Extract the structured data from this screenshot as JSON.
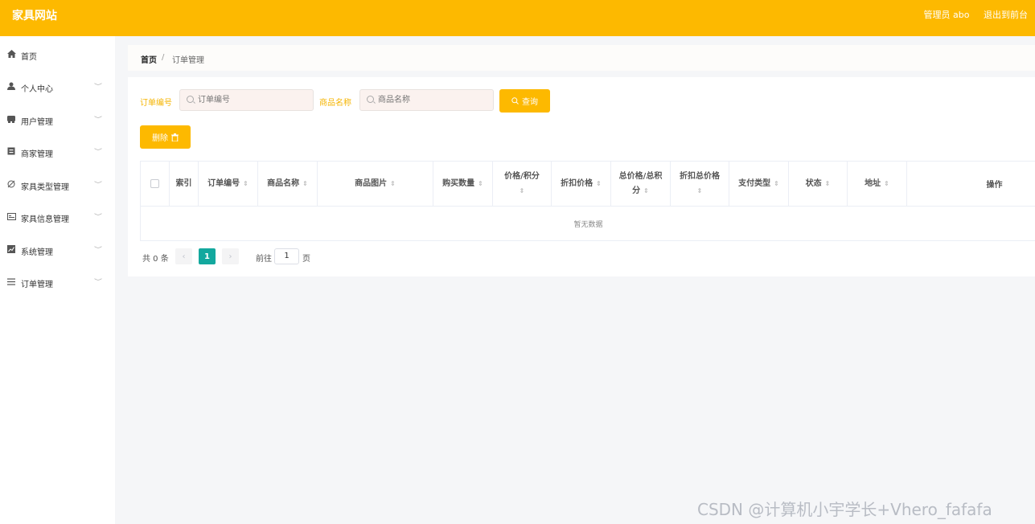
{
  "header": {
    "title": "家具网站",
    "admin_label": "管理员 abo",
    "exit_label": "退出到前台"
  },
  "sidebar": {
    "items": [
      {
        "label": "首页",
        "icon": "home-icon"
      },
      {
        "label": "个人中心",
        "icon": "user-icon"
      },
      {
        "label": "用户管理",
        "icon": "users-icon"
      },
      {
        "label": "商家管理",
        "icon": "merchant-icon"
      },
      {
        "label": "家具类型管理",
        "icon": "category-icon"
      },
      {
        "label": "家具信息管理",
        "icon": "info-icon"
      },
      {
        "label": "系统管理",
        "icon": "chart-icon"
      },
      {
        "label": "订单管理",
        "icon": "list-icon"
      }
    ]
  },
  "breadcrumb": {
    "home": "首页",
    "separator": "/",
    "current": "订单管理"
  },
  "filters": {
    "order_no_label": "订单编号",
    "order_no_placeholder": "订单编号",
    "product_name_label": "商品名称",
    "product_name_placeholder": "商品名称",
    "search_label": "查询",
    "delete_label": "删除"
  },
  "table": {
    "columns": {
      "index": "索引",
      "order_no": "订单编号",
      "product_name": "商品名称",
      "product_image": "商品图片",
      "quantity": "购买数量",
      "price": "价格/积分",
      "discount_price": "折扣价格",
      "total_price": "总价格/总积分",
      "discount_total": "折扣总价格",
      "payment_type": "支付类型",
      "status": "状态",
      "address": "地址",
      "actions": "操作"
    },
    "empty_text": "暂无数据"
  },
  "pagination": {
    "total": "共 0 条",
    "current_page": "1",
    "goto_label": "前往",
    "goto_value": "1",
    "page_unit": "页"
  },
  "watermark": "CSDN @计算机小宇学长+Vhero_fafafa",
  "colors": {
    "accent": "#fdb900",
    "page_active": "#13a89e"
  }
}
